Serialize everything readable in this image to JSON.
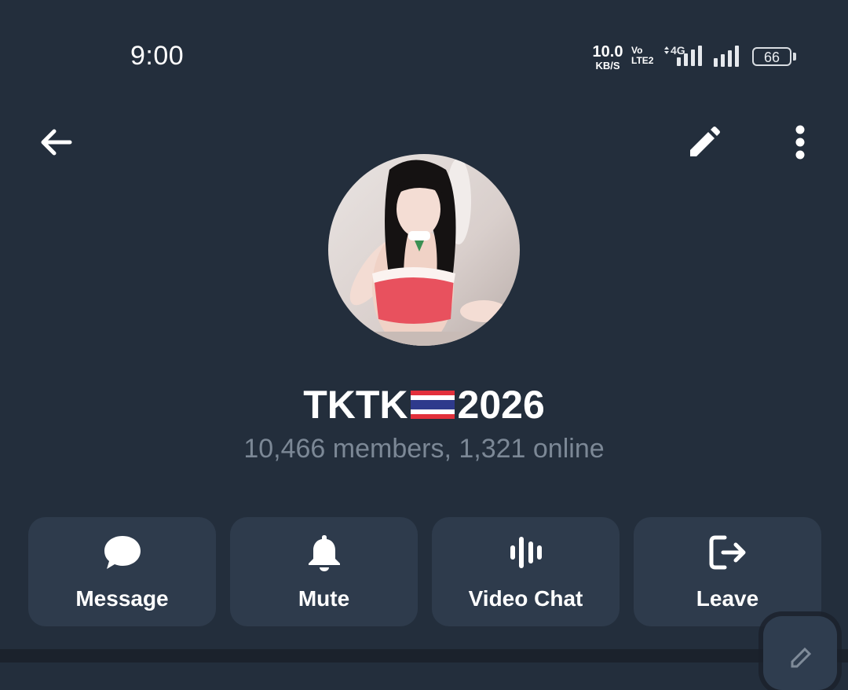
{
  "status_bar": {
    "time": "9:00",
    "net_speed_value": "10.0",
    "net_speed_unit": "KB/S",
    "volte_top": "Vo",
    "volte_bottom": "LTE2",
    "network_type": "4G",
    "battery": "66"
  },
  "header": {
    "back_icon": "arrow-left-icon",
    "edit_icon": "pencil-icon",
    "more_icon": "more-vertical-icon"
  },
  "profile": {
    "avatar_description": "group photo avatar",
    "name_prefix": "TKTK",
    "name_flag": "Thailand flag",
    "name_suffix": "2026",
    "subtitle": "10,466 members, 1,321 online"
  },
  "actions": [
    {
      "label": "Message",
      "icon": "chat-bubble-icon"
    },
    {
      "label": "Mute",
      "icon": "bell-icon"
    },
    {
      "label": "Video Chat",
      "icon": "voice-wave-icon"
    },
    {
      "label": "Leave",
      "icon": "leave-icon"
    }
  ],
  "colors": {
    "background": "#232e3c",
    "button": "#2e3b4c",
    "subtitle": "#7c8896"
  }
}
